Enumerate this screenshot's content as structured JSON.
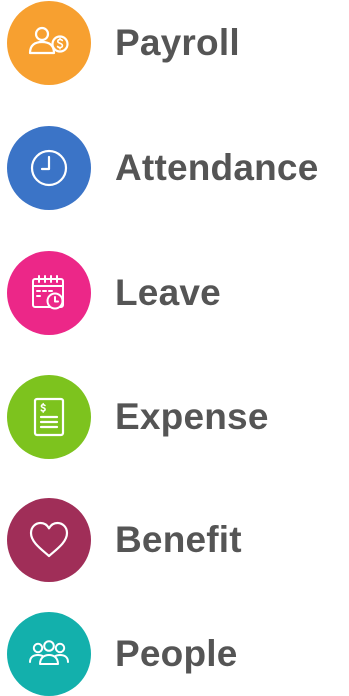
{
  "menu": {
    "items": [
      {
        "id": "payroll",
        "label": "Payroll",
        "icon": "payroll-people-dollar-icon",
        "color": "#F7A030"
      },
      {
        "id": "attendance",
        "label": "Attendance",
        "icon": "clock-icon",
        "color": "#3B74C7"
      },
      {
        "id": "leave",
        "label": "Leave",
        "icon": "calendar-clock-icon",
        "color": "#EC2788"
      },
      {
        "id": "expense",
        "label": "Expense",
        "icon": "receipt-dollar-icon",
        "color": "#7DC31E"
      },
      {
        "id": "benefit",
        "label": "Benefit",
        "icon": "heart-icon",
        "color": "#A02E58"
      },
      {
        "id": "people",
        "label": "People",
        "icon": "people-group-icon",
        "color": "#13B0AC"
      }
    ],
    "label_color": "#555555"
  }
}
